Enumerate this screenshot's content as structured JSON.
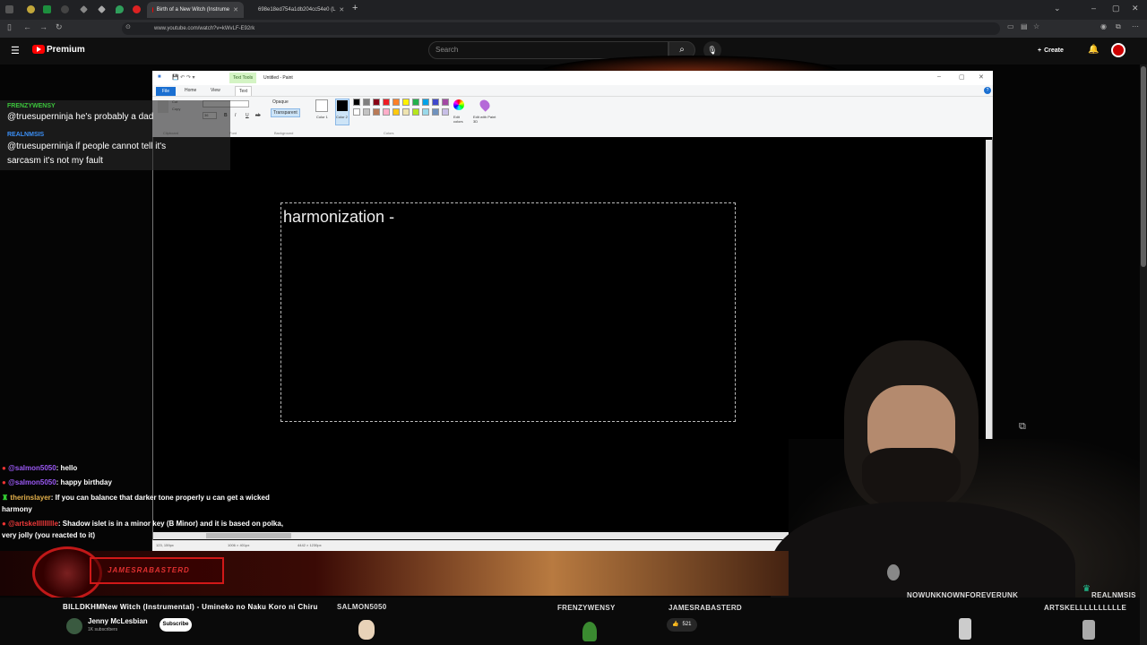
{
  "browser": {
    "tabs": [
      {
        "label": "Birth of a New Witch (Instrume",
        "active": true
      },
      {
        "label": "698e18ed754a1db204cc54e0 (L",
        "active": false
      }
    ],
    "url": "www.youtube.com/watch?v=kWvLF-E92rk",
    "new_tab": "+"
  },
  "youtube": {
    "brand": "Premium",
    "search_placeholder": "Search",
    "create_label": "Create"
  },
  "paint": {
    "title": "Untitled - Paint",
    "context_tab": "Text Tools",
    "tabs": [
      "File",
      "Home",
      "View",
      "Text"
    ],
    "clipboard_items": [
      "Cut",
      "Copy"
    ],
    "font_size": "36",
    "background_options": [
      "Opaque",
      "Transparent"
    ],
    "color1_label": "Color 1",
    "color2_label": "Color 2",
    "edit_colors_label": "Edit colors",
    "paint3d_label": "Edit with Paint 3D",
    "groups": [
      "Clipboard",
      "Font",
      "Background",
      "Colors"
    ],
    "canvas_text": "harmonization -",
    "status": {
      "pos": "123, 159px",
      "selection": "1006 × 401px",
      "size": "4442 × 1230px"
    },
    "palette": [
      "#000000",
      "#7f7f7f",
      "#880015",
      "#ed1c24",
      "#ff7f27",
      "#fff200",
      "#22b14c",
      "#00a2e8",
      "#3f48cc",
      "#a349a4",
      "#ffffff",
      "#c3c3c3",
      "#b97a57",
      "#ffaec9",
      "#ffc90e",
      "#efe4b0",
      "#b5e61d",
      "#99d9ea",
      "#7092be",
      "#c8bfe7"
    ]
  },
  "top_chat": [
    {
      "user": "FRENZYWENSY",
      "color": "#3cc43c",
      "text": "@truesuperninja he's probably a dad"
    },
    {
      "user": "REALNMSIS",
      "color": "#3b8ff5",
      "text": "@truesuperninja if people cannot tell it's sarcasm it's not my fault"
    }
  ],
  "bottom_chat": [
    {
      "user": "@salmon5050",
      "color": "#9b59f5",
      "text": ": hello"
    },
    {
      "user": "@salmon5050",
      "color": "#9b59f5",
      "text": ": happy birthday"
    },
    {
      "user": "therinslayer",
      "color": "#e3b04b",
      "text": ": If you can balance that darker tone properly u can get a wicked harmony"
    },
    {
      "user": "@artskellllllllle",
      "color": "#ee3a3a",
      "text": ": Shadow islet is in a minor key (B Minor) and it is based on polka, very jolly (you reacted to it)"
    }
  ],
  "overlay": {
    "now_playing": "New Witch (Instrumental) - Umineko no Naku Koro ni Chiru",
    "ticker_users": [
      "FRENZYWENSY",
      "JAMESRABASTERD",
      "NOWUNKNOWNFOREVERUNK",
      "REALNMSIS",
      "ARTSKELLLLLLLLLLE",
      "SALMON5050",
      "BILLDKHM"
    ],
    "channel_name": "Jenny McLesbian",
    "subscribers": "1K subscribers",
    "subscribe_label": "Subscribe",
    "like_count": "521",
    "badge_text": "JAMESRABASTERD"
  }
}
